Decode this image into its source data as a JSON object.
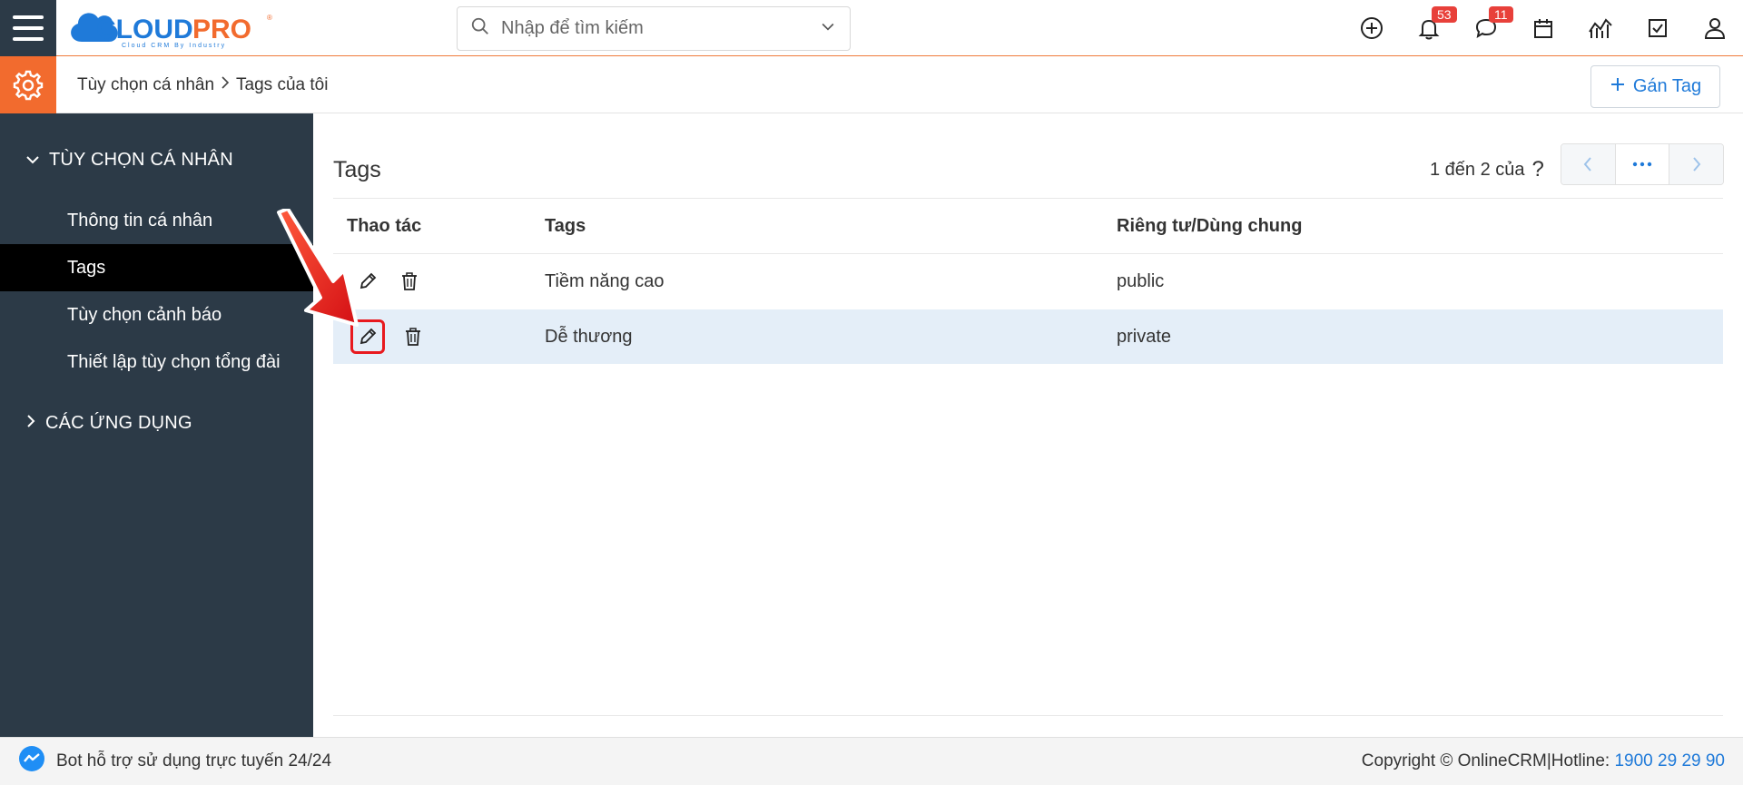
{
  "header": {
    "logo_text": "CLOUDPRO",
    "logo_tagline": "Cloud CRM By Industry",
    "search_placeholder": "Nhập để tìm kiếm",
    "notifications_count": "53",
    "messages_count": "11"
  },
  "subheader": {
    "breadcrumb_root": "Tùy chọn cá nhân",
    "breadcrumb_current": "Tags của tôi",
    "assign_tag_label": "Gán Tag"
  },
  "sidebar": {
    "section1_title": "TÙY CHỌN CÁ NHÂN",
    "items": [
      {
        "label": "Thông tin cá nhân"
      },
      {
        "label": "Tags"
      },
      {
        "label": "Tùy chọn cảnh báo"
      },
      {
        "label": "Thiết lập tùy chọn tổng đài"
      }
    ],
    "section2_title": "CÁC ỨNG DỤNG"
  },
  "main": {
    "title": "Tags",
    "pager_text": "1 đến 2 của",
    "pager_help": "?",
    "columns": [
      "Thao tác",
      "Tags",
      "Riêng tư/Dùng chung"
    ],
    "rows": [
      {
        "tag": "Tiềm năng cao",
        "visibility": "public"
      },
      {
        "tag": "Dễ thương",
        "visibility": "private"
      }
    ]
  },
  "footer": {
    "bot_text": "Bot hỗ trợ sử dụng trực tuyến 24/24",
    "copyright": "Copyright © OnlineCRM|Hotline:",
    "hotline": "1900 29 29 90"
  },
  "colors": {
    "brand_orange": "#f26b2e",
    "sidebar_bg": "#2c3a47",
    "accent_blue": "#1f7ad9",
    "badge_red": "#e8403a",
    "highlight_red": "#e8191e"
  }
}
